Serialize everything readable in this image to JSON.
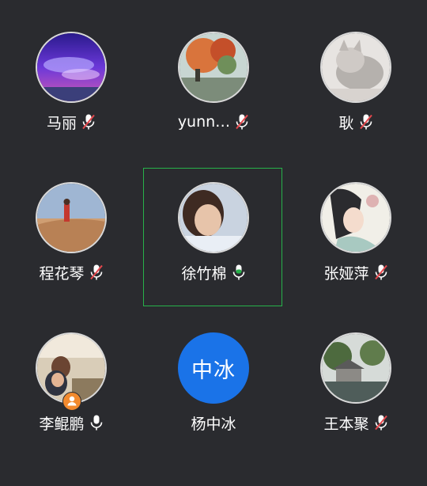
{
  "participants": [
    {
      "name": "马丽",
      "mic": "muted",
      "avatar": "purple-sky-photo"
    },
    {
      "name": "yunn…",
      "mic": "muted",
      "avatar": "autumn-tree-photo"
    },
    {
      "name": "耿",
      "mic": "muted",
      "avatar": "gray-cat-photo"
    },
    {
      "name": "程花琴",
      "mic": "muted",
      "avatar": "beach-person-photo"
    },
    {
      "name": "徐竹棉",
      "mic": "active",
      "avatar": "child-photo"
    },
    {
      "name": "张娅萍",
      "mic": "muted",
      "avatar": "anime-girl-illustration"
    },
    {
      "name": "李鲲鹏",
      "mic": "on",
      "avatar": "family-photo",
      "host": true
    },
    {
      "name": "杨中冰",
      "mic": "none",
      "initials": "中冰"
    },
    {
      "name": "王本聚",
      "mic": "muted",
      "avatar": "riverside-village-photo"
    }
  ],
  "colors": {
    "background": "#2a2b2f",
    "speaking_frame": "#27b24a",
    "muted_slash": "#e5484d",
    "initials_avatar": "#1a73e8",
    "host_badge": "#f28a2e"
  }
}
